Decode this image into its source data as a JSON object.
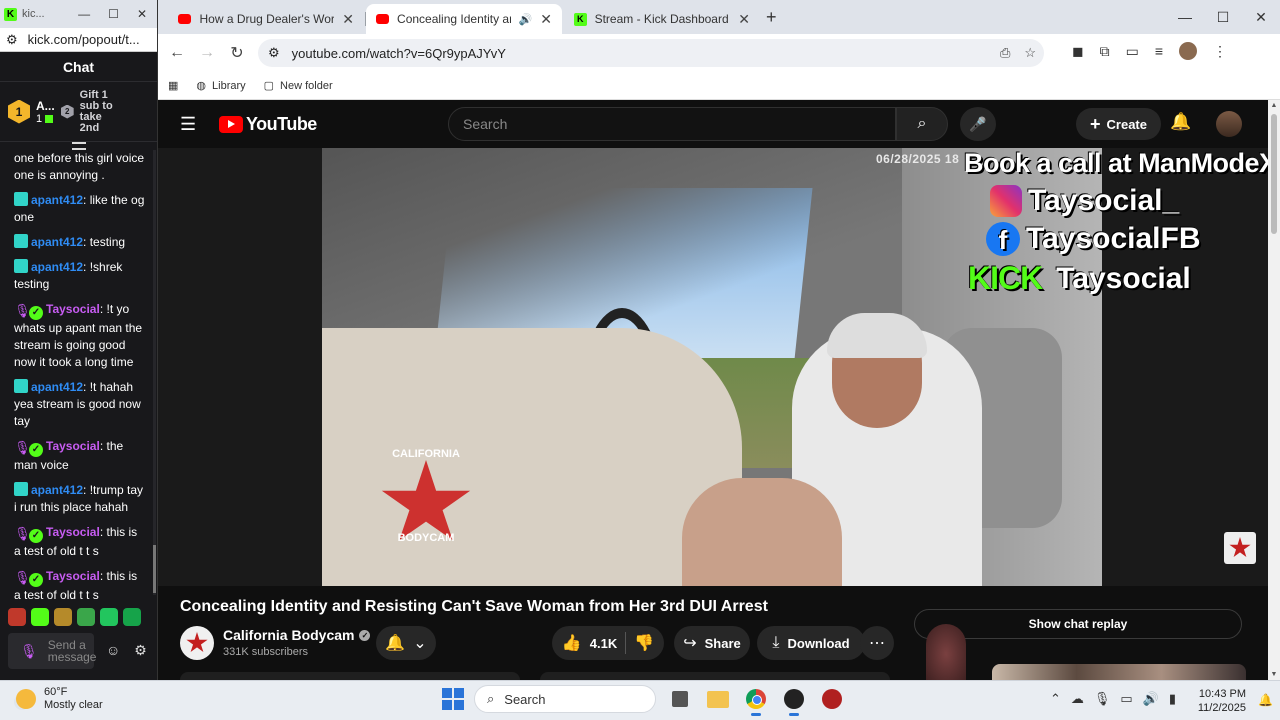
{
  "kick_popout": {
    "window_title": "kic...",
    "url": "kick.com/popout/t...",
    "chat_header": "Chat",
    "gift": {
      "rank1": "1",
      "user": "A...",
      "count": "1",
      "rank2": "2",
      "text": "Gift 1 sub to take 2nd"
    },
    "messages": [
      {
        "user": "",
        "text": "one before this girl voice one is annoying .",
        "type": "continuation"
      },
      {
        "user": "apant412",
        "text": ": like the og one",
        "type": "apant"
      },
      {
        "user": "apant412",
        "text": ": testing",
        "type": "apant"
      },
      {
        "user": "apant412",
        "text": ": !shrek testing",
        "type": "apant"
      },
      {
        "user": "Taysocial",
        "text": ": !t yo whats up apant man the stream is going good now it took a long time",
        "type": "tay"
      },
      {
        "user": "apant412",
        "text": ": !t hahah yea stream is good now tay",
        "type": "apant"
      },
      {
        "user": "Taysocial",
        "text": ": the man voice",
        "type": "tay"
      },
      {
        "user": "apant412",
        "text": ": !trump tay i run this place hahah",
        "type": "apant"
      },
      {
        "user": "Taysocial",
        "text": ": this is a test of old t t s",
        "type": "tay"
      },
      {
        "user": "Taysocial",
        "text": ": this is a test of old t t s",
        "type": "tay"
      }
    ],
    "input_placeholder": "Send a message"
  },
  "browser": {
    "tabs": [
      {
        "title": "How a Drug Dealer's Worst Nig",
        "icon": "youtube-icon",
        "active": false
      },
      {
        "title": "Concealing Identity and Res",
        "icon": "youtube-icon",
        "active": true
      },
      {
        "title": "Stream - Kick Dashboard",
        "icon": "kick-icon",
        "active": false
      }
    ],
    "url": "youtube.com/watch?v=6Qr9ypAJYvY",
    "bookmarks": [
      {
        "label": "Library",
        "icon": "globe-icon"
      },
      {
        "label": "New folder",
        "icon": "folder-icon"
      }
    ]
  },
  "youtube": {
    "logo": "YouTube",
    "search_placeholder": "Search",
    "create_label": "Create",
    "overlay": {
      "date": "06/28/2025 18",
      "book": "Book a call at ManModeX.com",
      "instagram": "Taysocial_",
      "facebook": "TaysocialFB",
      "kick_word": "KICK",
      "kick_handle": "Taysocial"
    },
    "video_title": "Concealing Identity and Resisting Can't Save Woman from Her 3rd DUI Arrest",
    "channel": {
      "name": "California Bodycam",
      "subscribers": "331K subscribers"
    },
    "likes": "4.1K",
    "share_label": "Share",
    "download_label": "Download",
    "chat_replay_label": "Show chat replay"
  },
  "taskbar": {
    "weather_temp": "60°F",
    "weather_desc": "Mostly clear",
    "search_label": "Search",
    "time": "10:43 PM",
    "date": "11/2/2025"
  }
}
